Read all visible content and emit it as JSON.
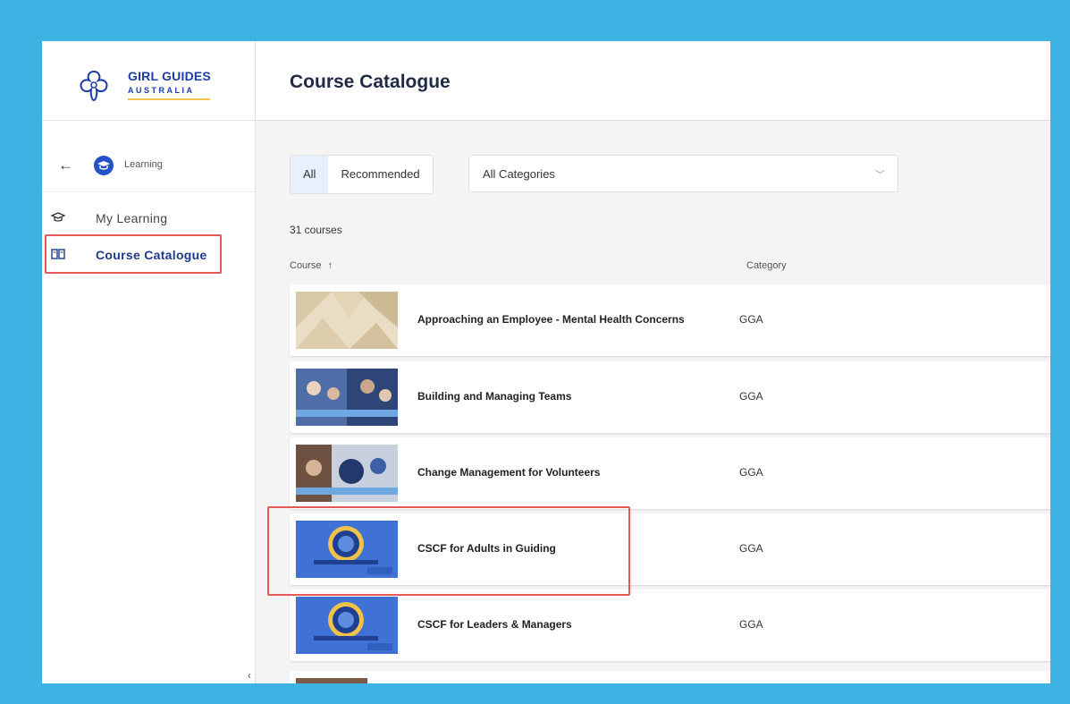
{
  "brand": {
    "name": "GIRL GUIDES",
    "sub": "AUSTRALIA"
  },
  "sidebar": {
    "back_label": "Learning",
    "items": [
      {
        "label": "My Learning",
        "icon": "graduation-cap-icon",
        "active": false
      },
      {
        "label": "Course Catalogue",
        "icon": "book-open-icon",
        "active": true
      }
    ]
  },
  "header": {
    "title": "Course Catalogue"
  },
  "filters": {
    "tabs": [
      {
        "label": "All",
        "active": true
      },
      {
        "label": "Recommended",
        "active": false
      }
    ],
    "category_select": "All Categories"
  },
  "results": {
    "count_label": "31 courses"
  },
  "table": {
    "columns": {
      "course": "Course",
      "sort_icon": "↑",
      "category": "Category"
    },
    "rows": [
      {
        "title": "Approaching an Employee - Mental Health Concerns",
        "category": "GGA",
        "thumb": "pattern-thumbnail"
      },
      {
        "title": "Building and Managing Teams",
        "category": "GGA",
        "thumb": "photo-thumbnail"
      },
      {
        "title": "Change Management for Volunteers",
        "category": "GGA",
        "thumb": "photo-thumbnail"
      },
      {
        "title": "CSCF for Adults in Guiding",
        "category": "GGA",
        "thumb": "cscf-thumbnail"
      },
      {
        "title": "CSCF for Leaders & Managers",
        "category": "GGA",
        "thumb": "cscf-thumbnail"
      }
    ]
  },
  "colors": {
    "accent": "#1f3a8a",
    "highlight": "#e45858",
    "frame": "#3db3e4"
  }
}
